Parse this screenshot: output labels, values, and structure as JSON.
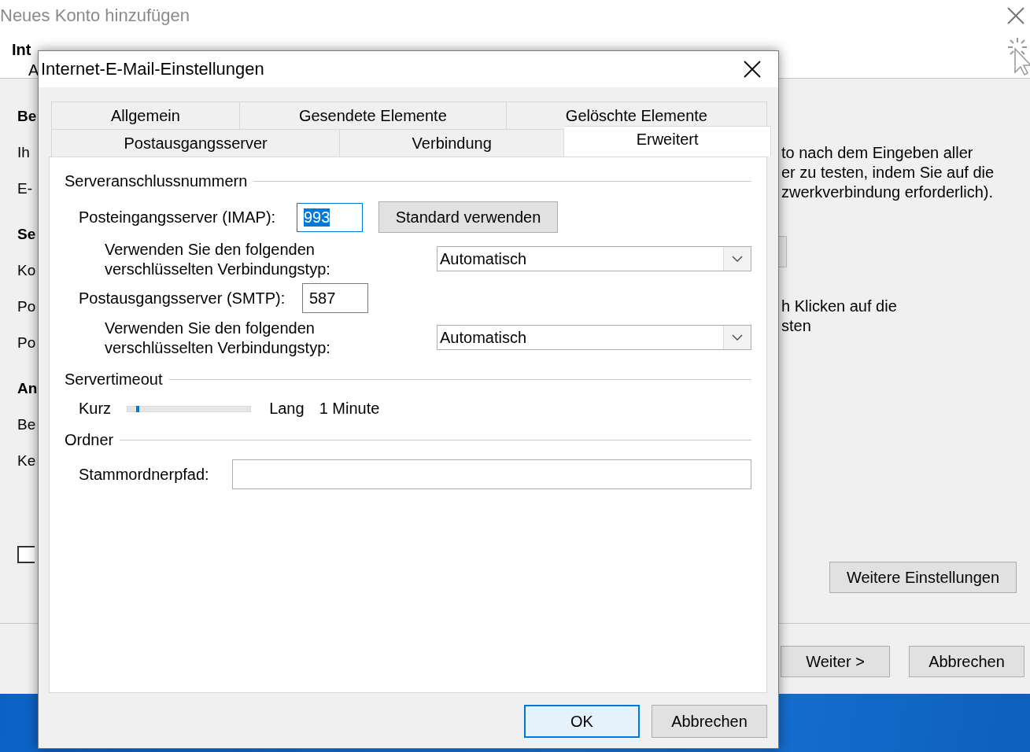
{
  "background_window": {
    "title": "Neues Konto hinzufügen",
    "heading": "Int",
    "subheading": "A",
    "left_fragments": [
      {
        "text": "Be",
        "kind": "heading"
      },
      {
        "text": "Ih",
        "kind": "label"
      },
      {
        "text": "E-",
        "kind": "label"
      },
      {
        "text": "Se",
        "kind": "heading"
      },
      {
        "text": "Ko",
        "kind": "label"
      },
      {
        "text": "Po",
        "kind": "label"
      },
      {
        "text": "Po",
        "kind": "label"
      },
      {
        "text": "An",
        "kind": "heading"
      },
      {
        "text": "Be",
        "kind": "label"
      },
      {
        "text": "Ke",
        "kind": "label"
      }
    ],
    "checkbox": {
      "checked": false
    },
    "right_paragraphs": [
      "to nach dem Eingeben aller\ner zu testen, indem Sie auf die\nzwerkverbindung erforderlich).",
      "h Klicken auf die\nsten"
    ],
    "more_settings_button": "Weitere Einstellungen",
    "footer_buttons": [
      "Weiter >",
      "Abbrechen"
    ]
  },
  "dialog": {
    "title": "Internet-E-Mail-Einstellungen",
    "tab_rows": [
      [
        {
          "label": "Allgemein",
          "selected": false
        },
        {
          "label": "Gesendete Elemente",
          "selected": false
        },
        {
          "label": "Gelöschte Elemente",
          "selected": false
        }
      ],
      [
        {
          "label": "Postausgangsserver",
          "selected": false
        },
        {
          "label": "Verbindung",
          "selected": false
        },
        {
          "label": "Erweitert",
          "selected": true
        }
      ]
    ],
    "ports": {
      "title": "Serveranschlussnummern",
      "incoming": {
        "label": "Posteingangsserver (IMAP):",
        "value": "993",
        "highlighted": true
      },
      "default_button": "Standard verwenden",
      "incoming_encryption": {
        "label": "Verwenden Sie den folgenden\nverschlüsselten Verbindungstyp:",
        "value": "Automatisch"
      },
      "outgoing": {
        "label": "Postausgangsserver (SMTP):",
        "value": "587",
        "highlighted": false
      },
      "outgoing_encryption": {
        "label": "Verwenden Sie den folgenden\nverschlüsselten Verbindungstyp:",
        "value": "Automatisch"
      }
    },
    "timeout": {
      "title": "Servertimeout",
      "min_label": "Kurz",
      "max_label": "Lang",
      "level": 0.08,
      "reading": "1 Minute"
    },
    "folder": {
      "title": "Ordner",
      "label": "Stammordnerpfad:"
    },
    "buttons": [
      {
        "label": "OK",
        "default": true
      },
      {
        "label": "Abbrechen",
        "default": false
      }
    ]
  }
}
